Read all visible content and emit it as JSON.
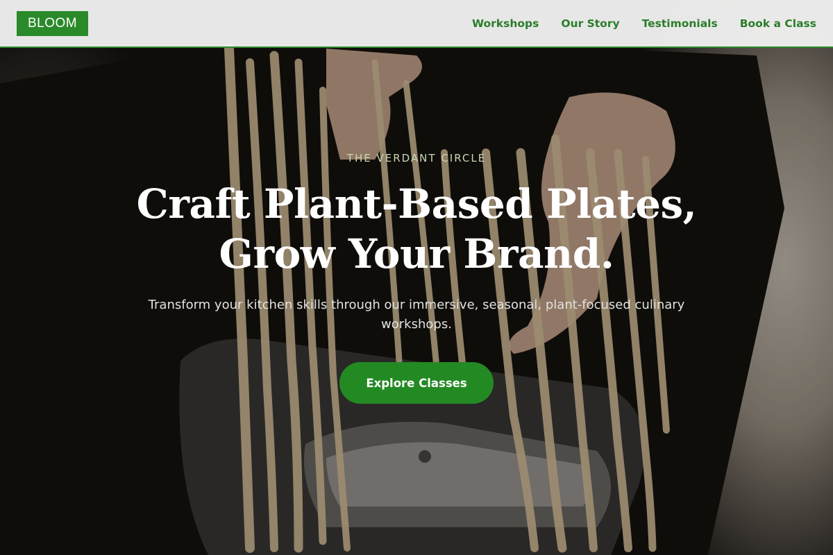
{
  "header": {
    "logo": "BLOOM",
    "nav": [
      {
        "label": "Workshops"
      },
      {
        "label": "Our Story"
      },
      {
        "label": "Testimonials"
      },
      {
        "label": "Book a Class"
      }
    ]
  },
  "hero": {
    "eyebrow": "THE VERDANT CIRCLE",
    "headline_line1": "Craft Plant-Based Plates,",
    "headline_line2": "Grow Your Brand.",
    "subtitle": "Transform your kitchen skills through our immersive, seasonal, plant-focused culinary workshops.",
    "cta": "Explore Classes",
    "background_image": "photo of hands holding fresh pasta ribbons above a pasta machine"
  },
  "colors": {
    "brand_green": "#2a8a2a",
    "nav_text": "#2a7d2a",
    "eyebrow_text": "#c9d7b4",
    "header_bg": "#f0f0f0"
  }
}
